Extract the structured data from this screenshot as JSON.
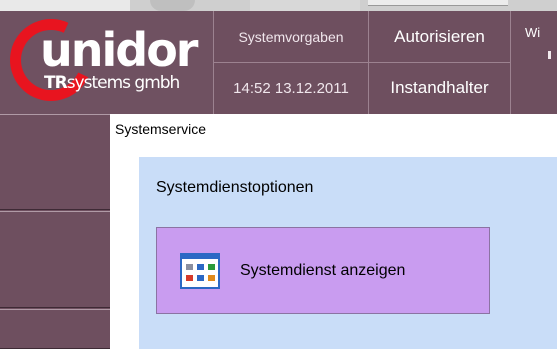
{
  "logo": {
    "word": "unidor",
    "sub_bold": "TR",
    "sub": "systems gmbh",
    "accent_color": "#e8141f"
  },
  "header": {
    "system_defaults": "Systemvorgaben",
    "datetime": "14:52 13.12.2011",
    "authorize": "Autorisieren",
    "role": "Instandhalter",
    "partial": "Wi"
  },
  "leftnav": {
    "item_count_visible": 3
  },
  "main": {
    "breadcrumb": "Systemservice",
    "panel_title": "Systemdienstoptionen",
    "service_button": "Systemdienst anzeigen",
    "service_icon": "service-grid-icon"
  },
  "colors": {
    "header_bg": "#6e4f5f",
    "panel_bg": "#c9ddf8",
    "button_bg": "#c99cf0"
  }
}
